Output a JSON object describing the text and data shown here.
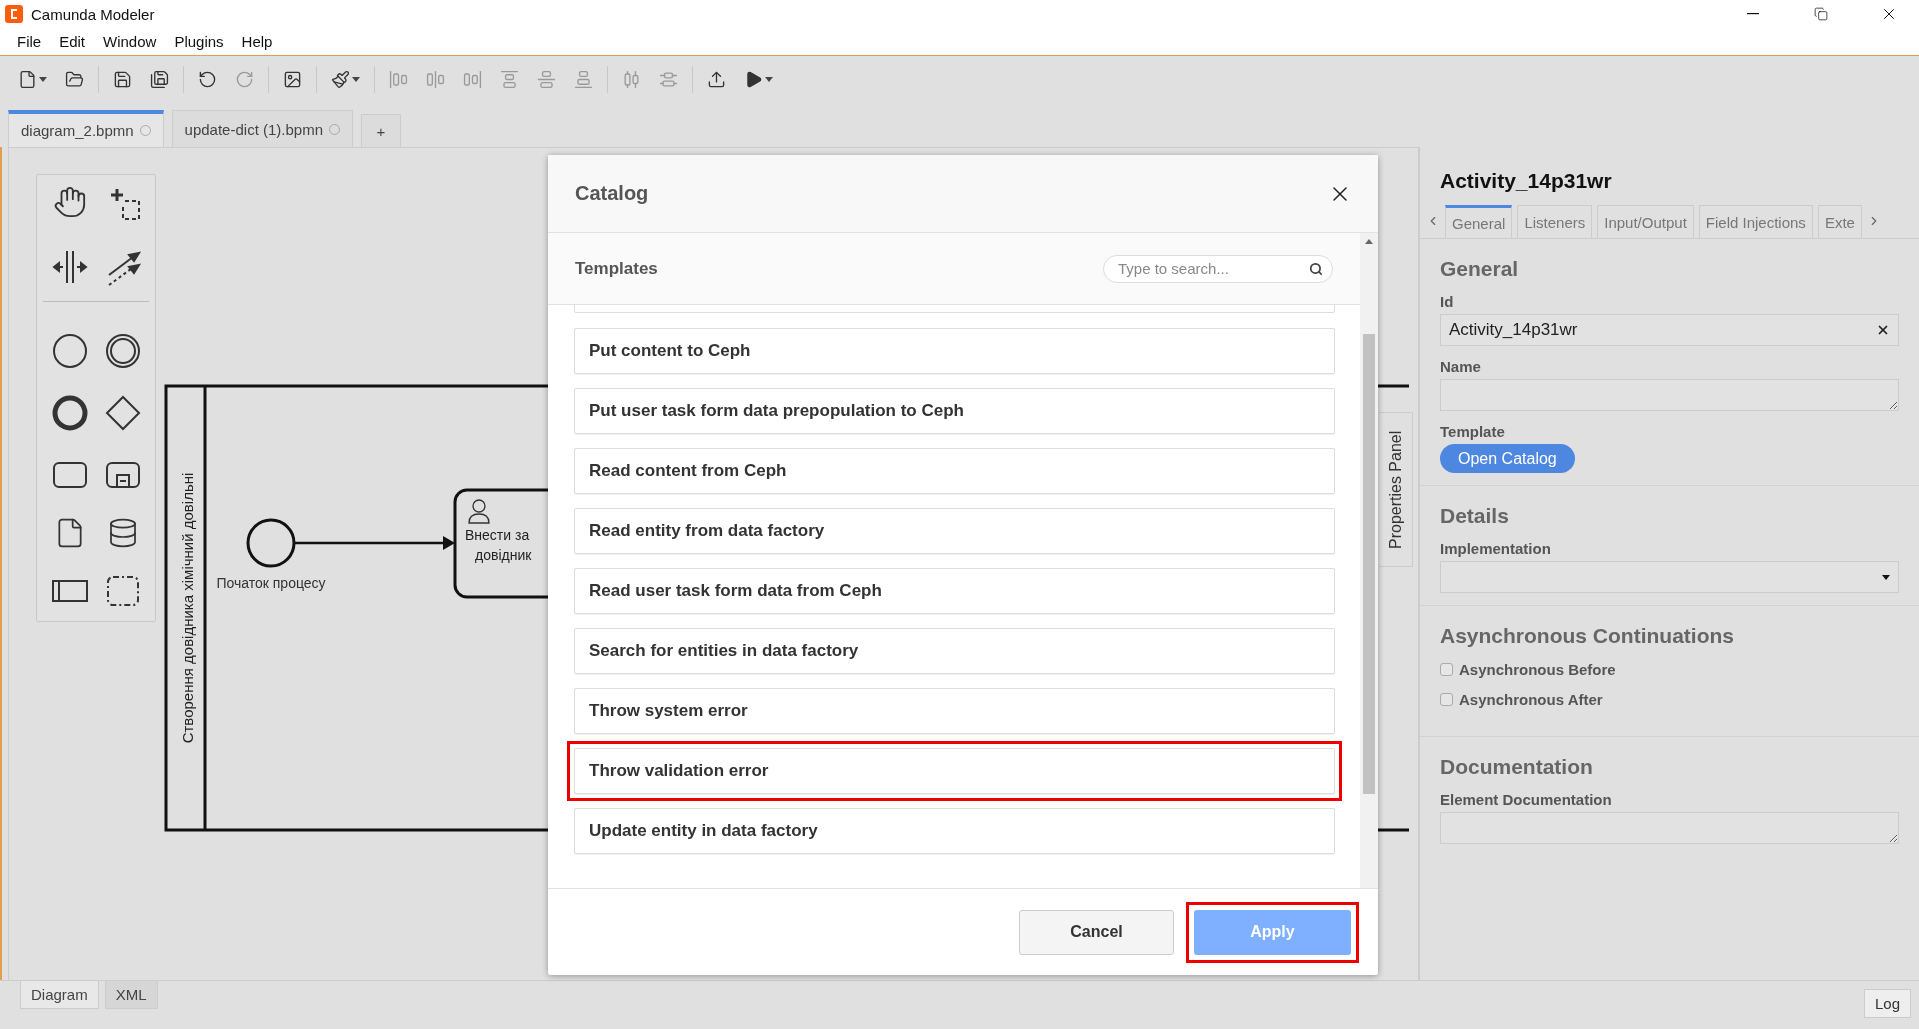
{
  "window": {
    "title": "Camunda Modeler"
  },
  "menu": [
    "File",
    "Edit",
    "Window",
    "Plugins",
    "Help"
  ],
  "toolbar": [
    [
      {
        "kind": "new",
        "caret": true,
        "disabled": false
      },
      {
        "kind": "open",
        "caret": false,
        "disabled": false
      }
    ],
    [
      {
        "kind": "save",
        "caret": false,
        "disabled": false
      },
      {
        "kind": "save_as",
        "caret": false,
        "disabled": false
      }
    ],
    [
      {
        "kind": "undo",
        "caret": false,
        "disabled": false
      },
      {
        "kind": "redo",
        "caret": false,
        "disabled": true
      }
    ],
    [
      {
        "kind": "image",
        "caret": false,
        "disabled": false
      }
    ],
    [
      {
        "kind": "brush",
        "caret": true,
        "disabled": false
      }
    ],
    [
      {
        "kind": "align_left",
        "caret": false,
        "disabled": true
      },
      {
        "kind": "align_center",
        "caret": false,
        "disabled": true
      },
      {
        "kind": "align_right",
        "caret": false,
        "disabled": true
      },
      {
        "kind": "align_top",
        "caret": false,
        "disabled": true
      },
      {
        "kind": "align_middle",
        "caret": false,
        "disabled": true
      },
      {
        "kind": "align_bottom",
        "caret": false,
        "disabled": true
      }
    ],
    [
      {
        "kind": "distribute_h",
        "caret": false,
        "disabled": true
      },
      {
        "kind": "distribute_v",
        "caret": false,
        "disabled": true
      }
    ],
    [
      {
        "kind": "deploy",
        "caret": false,
        "disabled": false
      },
      {
        "kind": "run",
        "caret": true,
        "disabled": false
      }
    ]
  ],
  "file_tabs": [
    {
      "label": "diagram_2.bpmn",
      "selected": true
    },
    {
      "label": "update-dict (1).bpmn",
      "selected": false
    }
  ],
  "new_tab": "+",
  "diagram": {
    "pool_label": "Створення довідника хімічний довільні",
    "start_event_label": "Початок процесу",
    "task_label": [
      "Внести за",
      "довідник"
    ]
  },
  "catalog": {
    "title": "Catalog",
    "section": "Templates",
    "search_placeholder": "Type to search...",
    "items": [
      {
        "label": "Put content to Ceph",
        "selected": false
      },
      {
        "label": "Put user task form data prepopulation to Ceph",
        "selected": false
      },
      {
        "label": "Read content from Ceph",
        "selected": false
      },
      {
        "label": "Read entity from data factory",
        "selected": false
      },
      {
        "label": "Read user task form data from Ceph",
        "selected": false
      },
      {
        "label": "Search for entities in data factory",
        "selected": false
      },
      {
        "label": "Throw system error",
        "selected": false
      },
      {
        "label": "Throw validation error",
        "selected": true
      },
      {
        "label": "Update entity in data factory",
        "selected": false
      }
    ],
    "cancel": "Cancel",
    "apply": {
      "label": "Apply",
      "disabled": true,
      "highlighted": true
    }
  },
  "properties_tab": "Properties Panel",
  "properties": {
    "title": "Activity_14p31wr",
    "tabs": [
      {
        "label": "General",
        "selected": true
      },
      {
        "label": "Listeners",
        "selected": false
      },
      {
        "label": "Input/Output",
        "selected": false
      },
      {
        "label": "Field Injections",
        "selected": false
      },
      {
        "label": "Exte",
        "selected": false
      }
    ],
    "general": {
      "heading": "General",
      "id_label": "Id",
      "id_value": "Activity_14p31wr",
      "name_label": "Name",
      "template_label": "Template",
      "open_catalog": "Open Catalog"
    },
    "details": {
      "heading": "Details",
      "implementation_label": "Implementation"
    },
    "async": {
      "heading": "Asynchronous Continuations",
      "options": [
        {
          "label": "Asynchronous Before",
          "checked": false
        },
        {
          "label": "Asynchronous After",
          "checked": false
        }
      ]
    },
    "documentation": {
      "heading": "Documentation",
      "label": "Element Documentation"
    }
  },
  "view_tabs": [
    {
      "label": "Diagram",
      "selected": true
    },
    {
      "label": "XML",
      "selected": false
    }
  ],
  "log": "Log"
}
